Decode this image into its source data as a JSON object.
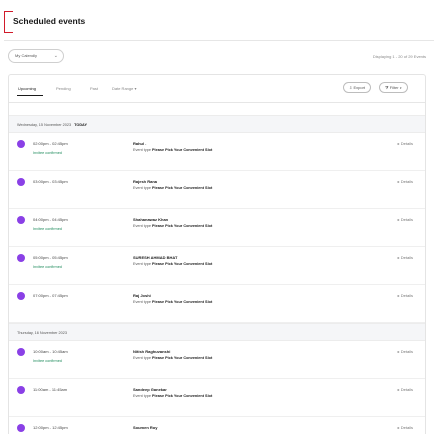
{
  "header": {
    "title": "Scheduled events"
  },
  "toolbar": {
    "calendar_select": "My Calendly",
    "count_text": "Displaying 1 - 20 of 29 Events"
  },
  "tabs": {
    "items": [
      {
        "label": "Upcoming"
      },
      {
        "label": "Pending"
      },
      {
        "label": "Past"
      },
      {
        "label": "Date Range ▾"
      }
    ],
    "export_label": "Export",
    "filter_label": "Filter ▾"
  },
  "days": [
    {
      "date": "Wednesday, 15 November 2023",
      "today": "TODAY"
    },
    {
      "date": "Thursday, 16 November 2023",
      "today": ""
    }
  ],
  "events": [
    {
      "time": "02:00pm - 02:45pm",
      "status": "Invitee confirmed",
      "name": "Rahul .",
      "event_type_label": "Event type",
      "event_type": "Please Pick Your Convenient Slot",
      "details": "Details"
    },
    {
      "time": "03:00pm - 03:45pm",
      "status": "",
      "name": "Rajesh Rana",
      "event_type_label": "Event type",
      "event_type": "Please Pick Your Convenient Slot",
      "details": "Details"
    },
    {
      "time": "04:00pm - 04:45pm",
      "status": "Invitee confirmed",
      "name": "Shahanawaz Khan",
      "event_type_label": "Event type",
      "event_type": "Please Pick Your Convenient Slot",
      "details": "Details"
    },
    {
      "time": "05:00pm - 05:45pm",
      "status": "Invitee confirmed",
      "name": "SURESH AHMAD BHAT",
      "event_type_label": "Event type",
      "event_type": "Please Pick Your Convenient Slot",
      "details": "Details"
    },
    {
      "time": "07:00pm - 07:45pm",
      "status": "",
      "name": "Raj Joshi",
      "event_type_label": "Event type",
      "event_type": "Please Pick Your Convenient Slot",
      "details": "Details"
    },
    {
      "time": "10:00am - 10:45am",
      "status": "Invitee confirmed",
      "name": "Nitish Raghuvanshi",
      "event_type_label": "Event type",
      "event_type": "Please Pick Your Convenient Slot",
      "details": "Details"
    },
    {
      "time": "11:00am - 11:45am",
      "status": "",
      "name": "Sandeep Ganekar",
      "event_type_label": "Event type",
      "event_type": "Please Pick Your Convenient Slot",
      "details": "Details"
    },
    {
      "time": "12:00pm - 12:45pm",
      "status": "",
      "name": "Soumen Roy",
      "event_type_label": "",
      "event_type": "",
      "details": "Details"
    }
  ],
  "colors": {
    "accent": "#d11a2a",
    "event_dot": "#8a40e6",
    "confirmed": "#1d8a5b"
  }
}
